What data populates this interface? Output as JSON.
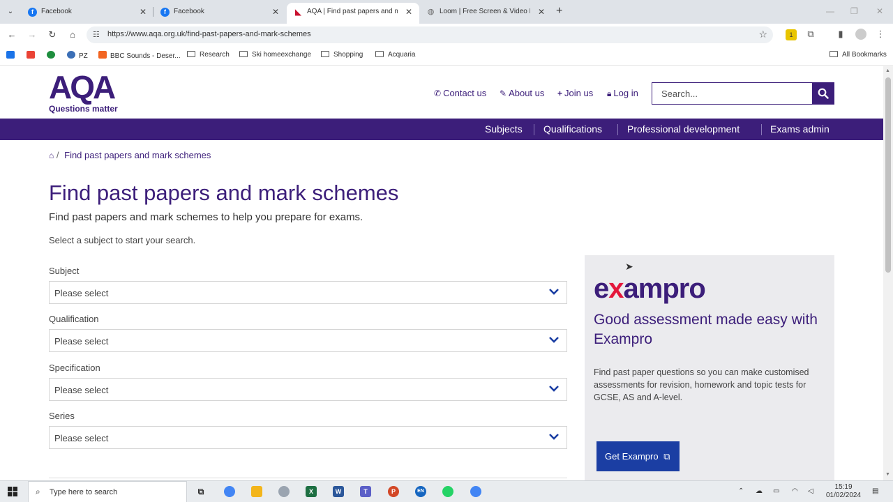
{
  "browser": {
    "tabs": [
      {
        "label": "Facebook",
        "favicon": "facebook-icon",
        "color": "#1877f2",
        "active": false
      },
      {
        "label": "Facebook",
        "favicon": "facebook-icon",
        "color": "#1877f2",
        "active": false
      },
      {
        "label": "AQA | Find past papers and ma",
        "favicon": "aqa-icon",
        "color": "#c8102e",
        "active": true
      },
      {
        "label": "Loom | Free Screen & Video Re",
        "favicon": "globe-icon",
        "color": "#777777",
        "active": false
      }
    ],
    "url": "https://www.aqa.org.uk/find-past-papers-and-mark-schemes",
    "bookmarks": [
      "PZ",
      "BBC Sounds - Deser...",
      "Research",
      "Ski homeexchange",
      "Shopping",
      "Acquaria"
    ],
    "all_bookmarks": "All Bookmarks"
  },
  "header": {
    "logo": "AQA",
    "tagline": "Questions matter",
    "links": {
      "contact": "Contact us",
      "about": "About us",
      "join": "Join us",
      "login": "Log in"
    },
    "search_placeholder": "Search..."
  },
  "nav": {
    "subjects": "Subjects",
    "qualifications": "Qualifications",
    "professional": "Professional development",
    "exams_admin": "Exams admin"
  },
  "breadcrumb": {
    "separator": "/",
    "current": "Find past papers and mark schemes"
  },
  "main": {
    "title": "Find past papers and mark schemes",
    "subtitle": "Find past papers and mark schemes to help you prepare for exams.",
    "prompt": "Select a subject to start your search.",
    "fields": {
      "subject": {
        "label": "Subject",
        "value": "Please select"
      },
      "qualification": {
        "label": "Qualification",
        "value": "Please select"
      },
      "specification": {
        "label": "Specification",
        "value": "Please select"
      },
      "series": {
        "label": "Series",
        "value": "Please select"
      }
    }
  },
  "promo": {
    "logo_pre": "e",
    "logo_x": "x",
    "logo_post": "ampro",
    "heading": "Good assessment made easy with Exampro",
    "text": "Find past paper questions so you can make customised assessments for revision, homework and topic tests for GCSE, AS and A-level.",
    "button": "Get Exampro"
  },
  "taskbar": {
    "search": "Type here to search",
    "lang": "EN",
    "time": "15:19",
    "date": "01/02/2024"
  },
  "colors": {
    "brand": "#3c1e7a",
    "button_blue": "#1b3ea3",
    "exampro_red": "#e4173b"
  }
}
